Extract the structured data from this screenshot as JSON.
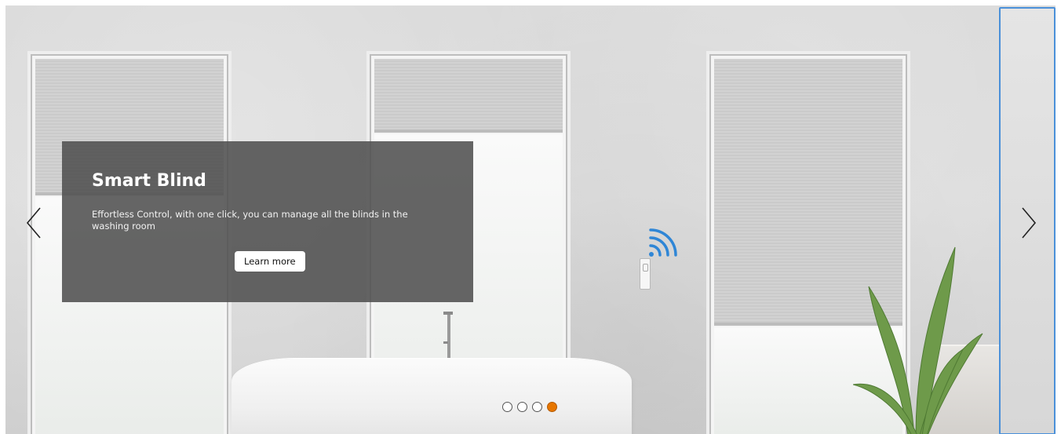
{
  "hero": {
    "title": "Smart Blind",
    "description": "Effortless Control, with one click, you can manage all the blinds in the washing room",
    "cta_label": "Learn more"
  },
  "carousel": {
    "slide_count": 4,
    "active_index": 3,
    "active_dot_color": "#e77600",
    "prev_icon": "chevron-left-icon",
    "next_icon": "chevron-right-icon"
  }
}
